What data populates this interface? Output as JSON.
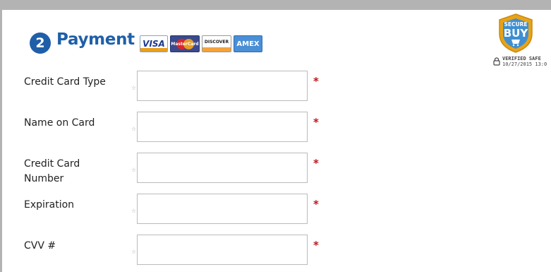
{
  "header": {
    "step_number": "2",
    "title": "Payment"
  },
  "card_logos": [
    {
      "name": "visa",
      "label": "VISA"
    },
    {
      "name": "mastercard",
      "label": "MasterCard"
    },
    {
      "name": "discover",
      "label": "DISCOVER"
    },
    {
      "name": "amex",
      "label": "AMEX"
    }
  ],
  "seal": {
    "top_text": "SECURE",
    "main_text": "BUY",
    "verified": "VERIFIED SAFE",
    "date": "10/27/2015 13:0"
  },
  "form": {
    "required_mark": "*",
    "hint_mark": "☆",
    "fields": [
      {
        "label": "Credit Card Type",
        "value": ""
      },
      {
        "label": "Name on Card",
        "value": ""
      },
      {
        "label": "Credit Card Number",
        "value": ""
      },
      {
        "label": "Expiration",
        "value": ""
      },
      {
        "label": "CVV #",
        "value": ""
      }
    ]
  },
  "colors": {
    "accent": "#1f5fa8",
    "required": "#c0161c",
    "frame": "#b3b3b3"
  }
}
